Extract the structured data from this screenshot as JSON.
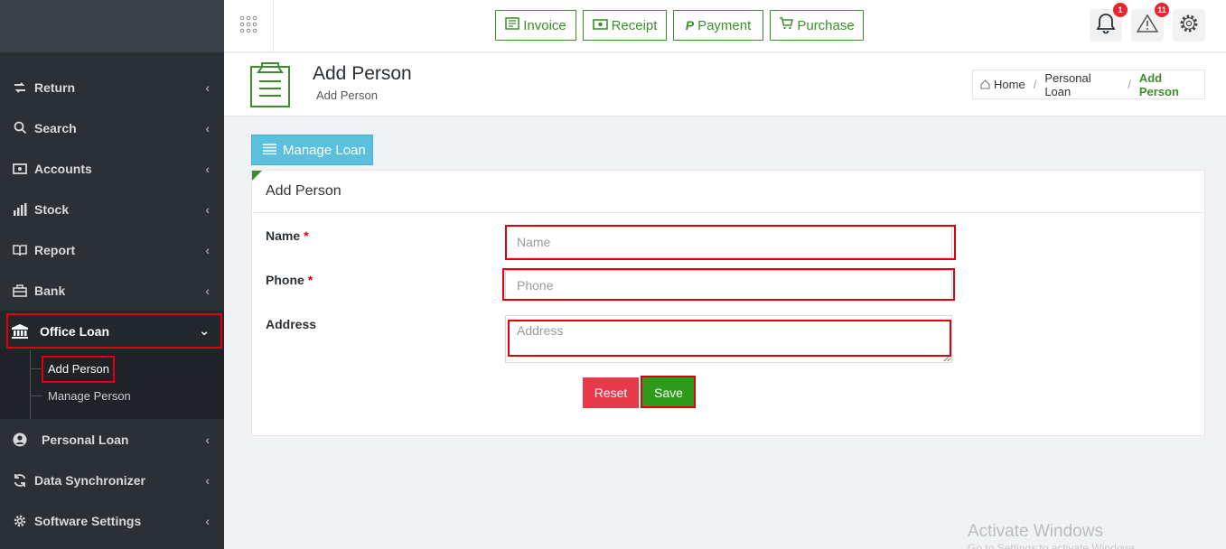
{
  "sidebar": {
    "items": [
      {
        "label": "Return",
        "icon": "return-icon"
      },
      {
        "label": "Search",
        "icon": "search-icon"
      },
      {
        "label": "Accounts",
        "icon": "money-icon"
      },
      {
        "label": "Stock",
        "icon": "bar-chart-icon"
      },
      {
        "label": "Report",
        "icon": "book-icon"
      },
      {
        "label": "Bank",
        "icon": "briefcase-icon"
      },
      {
        "label": "Office Loan",
        "icon": "bank-icon"
      },
      {
        "label": "Personal Loan",
        "icon": "user-icon"
      },
      {
        "label": "Data Synchronizer",
        "icon": "sync-icon"
      },
      {
        "label": "Software Settings",
        "icon": "gear-icon"
      }
    ],
    "submenu": [
      {
        "label": "Add Person"
      },
      {
        "label": "Manage Person"
      }
    ]
  },
  "topbar": {
    "buttons": [
      {
        "label": "Invoice",
        "icon": "invoice-icon"
      },
      {
        "label": "Receipt",
        "icon": "cash-icon"
      },
      {
        "label": "Payment",
        "icon": "paypal-icon"
      },
      {
        "label": "Purchase",
        "icon": "cart-icon"
      }
    ],
    "notifications_count": "1",
    "alerts_count": "11"
  },
  "page": {
    "title": "Add Person",
    "subtitle": "Add Person",
    "breadcrumb": [
      "Home",
      "Personal Loan",
      "Add Person"
    ]
  },
  "content": {
    "manage_button": "Manage Loan",
    "card_title": "Add Person",
    "fields": {
      "name_label": "Name",
      "name_placeholder": "Name",
      "phone_label": "Phone",
      "phone_placeholder": "Phone",
      "address_label": "Address",
      "address_placeholder": "Address",
      "required_mark": "*"
    },
    "reset_label": "Reset",
    "save_label": "Save"
  },
  "watermark": {
    "line1": "Activate Windows",
    "line2": "Go to Settings to activate Windows."
  },
  "colors": {
    "accent_green": "#3a8f2a",
    "sidebar_bg": "#2b3035",
    "danger": "#e8394a",
    "save_green": "#2d9a1c",
    "info": "#5bc0de",
    "highlight_red": "#e0000b"
  }
}
